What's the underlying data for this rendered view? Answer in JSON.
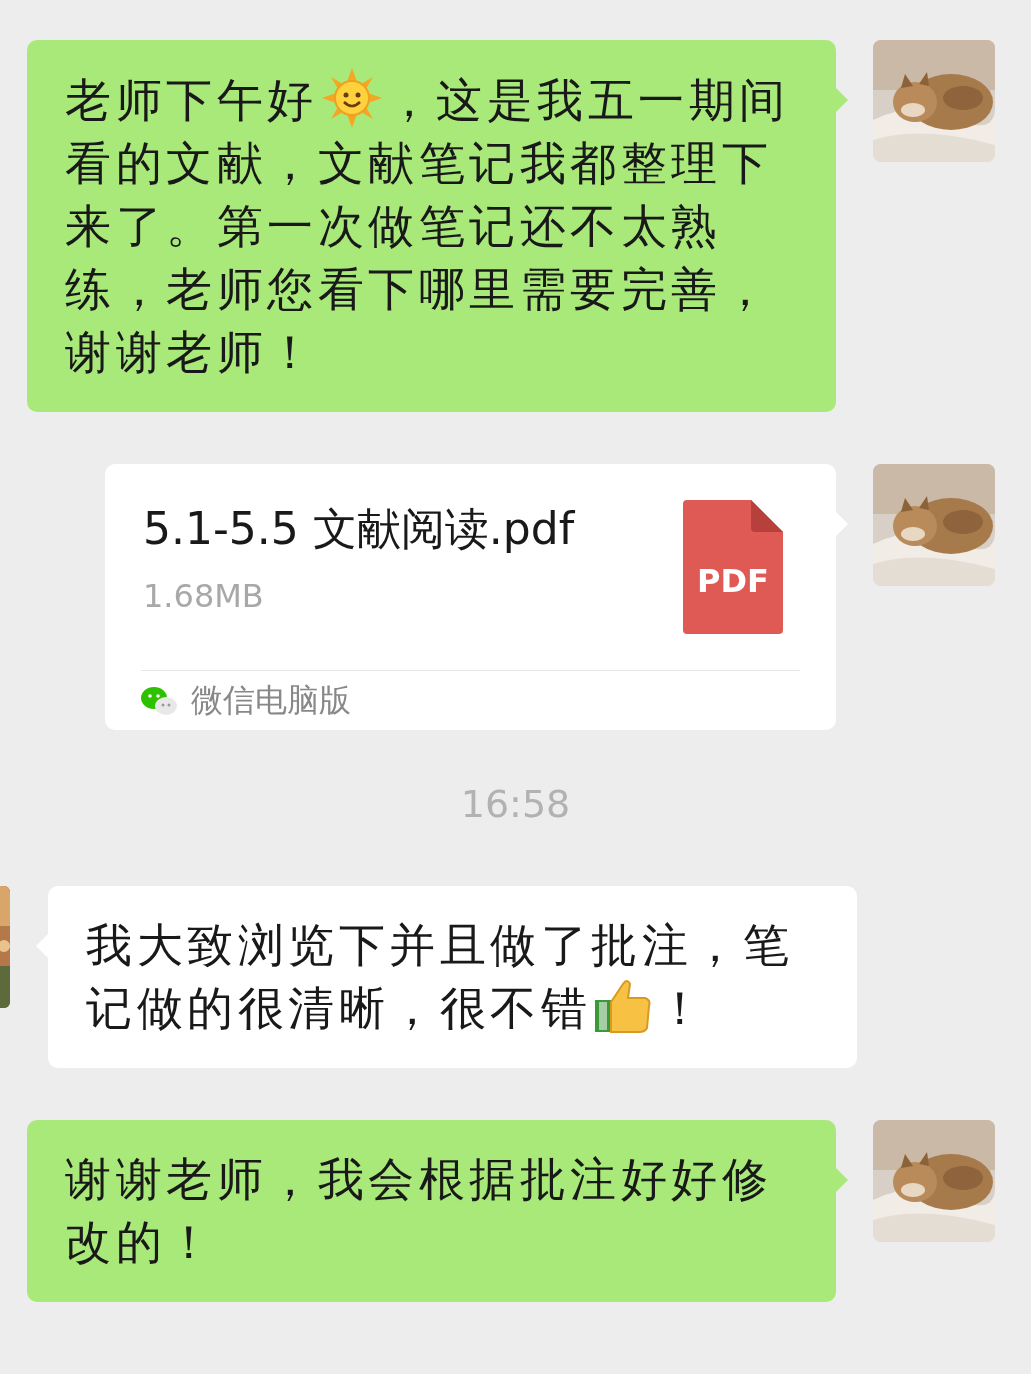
{
  "messages": [
    {
      "kind": "text",
      "outgoing": true,
      "parts": [
        {
          "kind": "text",
          "text": "老师下午好"
        },
        {
          "kind": "sun"
        },
        {
          "kind": "text",
          "text": "，这是我五一期间看的文献，文献笔记我都整理下来了。第一次做笔记还不太熟练，老师您看下哪里需要完善，谢谢老师！"
        }
      ]
    },
    {
      "kind": "file",
      "outgoing": true,
      "name": "5.1-5.5 文献阅读.pdf",
      "size": "1.68MB",
      "badge": "PDF",
      "source": "微信电脑版"
    },
    {
      "kind": "time",
      "text": "16:58"
    },
    {
      "kind": "text",
      "outgoing": false,
      "parts": [
        {
          "kind": "text",
          "text": "我大致浏览下并且做了批注，笔记做的很清晰，很不错"
        },
        {
          "kind": "thumbs_up"
        },
        {
          "kind": "text",
          "text": "！"
        }
      ]
    },
    {
      "kind": "text",
      "outgoing": true,
      "parts": [
        {
          "kind": "text",
          "text": "谢谢老师，我会根据批注好好修改的！"
        }
      ]
    }
  ]
}
